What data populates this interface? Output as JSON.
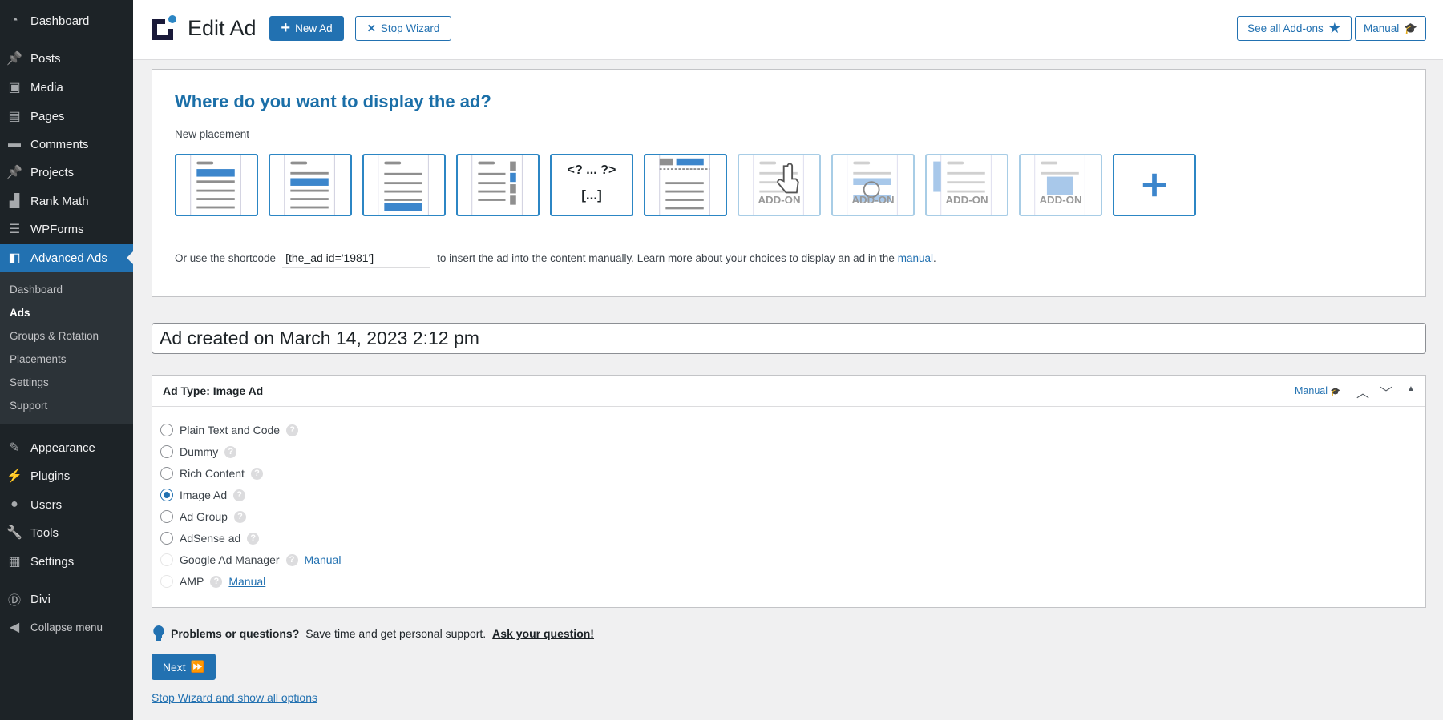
{
  "sidebar": {
    "items": [
      {
        "label": "Dashboard",
        "icon": "dashboard-icon"
      },
      {
        "label": "Posts",
        "icon": "pin-icon"
      },
      {
        "label": "Media",
        "icon": "media-icon"
      },
      {
        "label": "Pages",
        "icon": "pages-icon"
      },
      {
        "label": "Comments",
        "icon": "comment-icon"
      },
      {
        "label": "Projects",
        "icon": "pin-icon"
      },
      {
        "label": "Rank Math",
        "icon": "chart-icon"
      },
      {
        "label": "WPForms",
        "icon": "form-icon"
      },
      {
        "label": "Advanced Ads",
        "icon": "advanced-ads-icon"
      },
      {
        "label": "Appearance",
        "icon": "brush-icon"
      },
      {
        "label": "Plugins",
        "icon": "plug-icon"
      },
      {
        "label": "Users",
        "icon": "user-icon"
      },
      {
        "label": "Tools",
        "icon": "wrench-icon"
      },
      {
        "label": "Settings",
        "icon": "settings-icon"
      },
      {
        "label": "Divi",
        "icon": "divi-icon"
      },
      {
        "label": "Collapse menu",
        "icon": "collapse-icon"
      }
    ],
    "submenu": [
      "Dashboard",
      "Ads",
      "Groups & Rotation",
      "Placements",
      "Settings",
      "Support"
    ]
  },
  "header": {
    "title": "Edit Ad",
    "new_ad": "New Ad",
    "stop_wizard": "Stop Wizard",
    "addons": "See all Add-ons",
    "manual": "Manual"
  },
  "placement": {
    "heading": "Where do you want to display the ad?",
    "label": "New placement",
    "php_top": "<? ... ?>",
    "php_bottom": "[...]",
    "addon": "ADD-ON",
    "shortcode_prefix": "Or use the shortcode",
    "shortcode": "[the_ad id='1981']",
    "shortcode_suffix": "to insert the ad into the content manually. Learn more about your choices to display an ad in the",
    "manual_link": "manual",
    "period": "."
  },
  "title_input": "Ad created on March 14, 2023 2:12 pm",
  "ad_type": {
    "title": "Ad Type: Image Ad",
    "manual": "Manual",
    "options": [
      {
        "label": "Plain Text and Code",
        "state": "off"
      },
      {
        "label": "Dummy",
        "state": "off"
      },
      {
        "label": "Rich Content",
        "state": "off"
      },
      {
        "label": "Image Ad",
        "state": "on"
      },
      {
        "label": "Ad Group",
        "state": "off"
      },
      {
        "label": "AdSense ad",
        "state": "off"
      },
      {
        "label": "Google Ad Manager",
        "state": "disabled",
        "link": "Manual"
      },
      {
        "label": "AMP",
        "state": "disabled",
        "link": "Manual"
      }
    ]
  },
  "help": {
    "bold": "Problems or questions?",
    "text": "Save time and get personal support.",
    "link": "Ask your question!"
  },
  "next": "Next",
  "stop_link": "Stop Wizard and show all options"
}
